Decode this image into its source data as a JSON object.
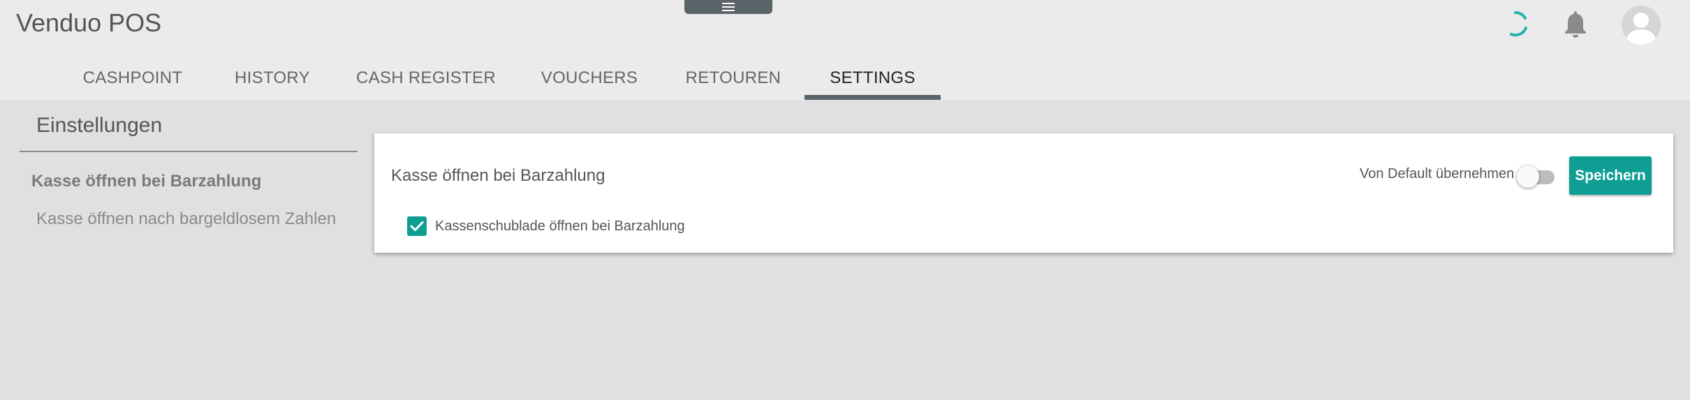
{
  "app": {
    "title": "Venduo POS"
  },
  "tabs": [
    {
      "label": "CASHPOINT",
      "active": false
    },
    {
      "label": "HISTORY",
      "active": false
    },
    {
      "label": "CASH REGISTER",
      "active": false
    },
    {
      "label": "VOUCHERS",
      "active": false
    },
    {
      "label": "RETOUREN",
      "active": false
    },
    {
      "label": "SETTINGS",
      "active": true
    }
  ],
  "sidebar": {
    "title": "Einstellungen",
    "items": [
      {
        "label": "Kasse öffnen bei Barzahlung",
        "active": true
      },
      {
        "label": "Kasse öffnen nach bargeldlosem Zahlen",
        "active": false
      }
    ]
  },
  "card": {
    "title": "Kasse öffnen bei Barzahlung",
    "default_label": "Von Default übernehmen",
    "default_toggle_on": false,
    "save_label": "Speichern",
    "checkbox_label": "Kassenschublade öffnen bei Barzahlung",
    "checkbox_checked": true
  },
  "icons": {
    "menu": "menu-icon",
    "loading": "loading-spinner-icon",
    "notifications": "bell-icon",
    "account": "user-avatar-icon",
    "check": "check-icon"
  },
  "colors": {
    "accent": "#0e9e94",
    "spinner": "#26b3a6",
    "tab_indicator": "#5a6468",
    "header_bg": "#ebebeb",
    "page_bg": "#e0e0e0"
  }
}
